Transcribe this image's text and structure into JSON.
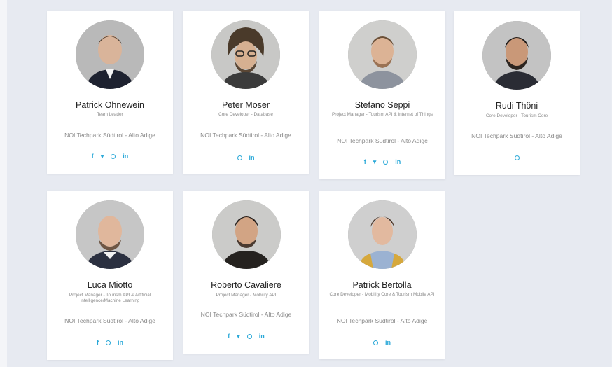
{
  "members": [
    {
      "name": "Patrick Ohnewein",
      "role": "Team Leader",
      "location": "NOI Techpark Südtirol - Alto Adige",
      "social": [
        "facebook",
        "twitter",
        "github",
        "linkedin"
      ]
    },
    {
      "name": "Peter Moser",
      "role": "Core Developer - Database",
      "location": "NOI Techpark Südtirol - Alto Adige",
      "social": [
        "github",
        "linkedin"
      ]
    },
    {
      "name": "Stefano Seppi",
      "role": "Project Manager - Tourism API & Internet of Things",
      "location": "NOI Techpark Südtirol - Alto Adige",
      "social": [
        "facebook",
        "twitter",
        "github",
        "linkedin"
      ]
    },
    {
      "name": "Rudi Thöni",
      "role": "Core Developer - Tourism Core",
      "location": "NOI Techpark Südtirol - Alto Adige",
      "social": [
        "github"
      ]
    },
    {
      "name": "Luca Miotto",
      "role": "Project Manager - Tourism API & Artificial Intelligence/Machine Learning",
      "location": "NOI Techpark Südtirol - Alto Adige",
      "social": [
        "facebook",
        "github",
        "linkedin"
      ]
    },
    {
      "name": "Roberto Cavaliere",
      "role": "Project Manager - Mobility API",
      "location": "NOI Techpark Südtirol - Alto Adige",
      "social": [
        "facebook",
        "twitter",
        "github",
        "linkedin"
      ]
    },
    {
      "name": "Patrick Bertolla",
      "role": "Core Developer - Mobility Core & Tourism Mobile API",
      "location": "NOI Techpark Südtirol - Alto Adige",
      "social": [
        "github",
        "linkedin"
      ]
    }
  ],
  "social_glyphs": {
    "facebook": "f",
    "twitter": "",
    "github": "",
    "linkedin": "in"
  },
  "colors": {
    "accent": "#29a8d8",
    "background": "#e7eaf1",
    "card": "#ffffff"
  }
}
